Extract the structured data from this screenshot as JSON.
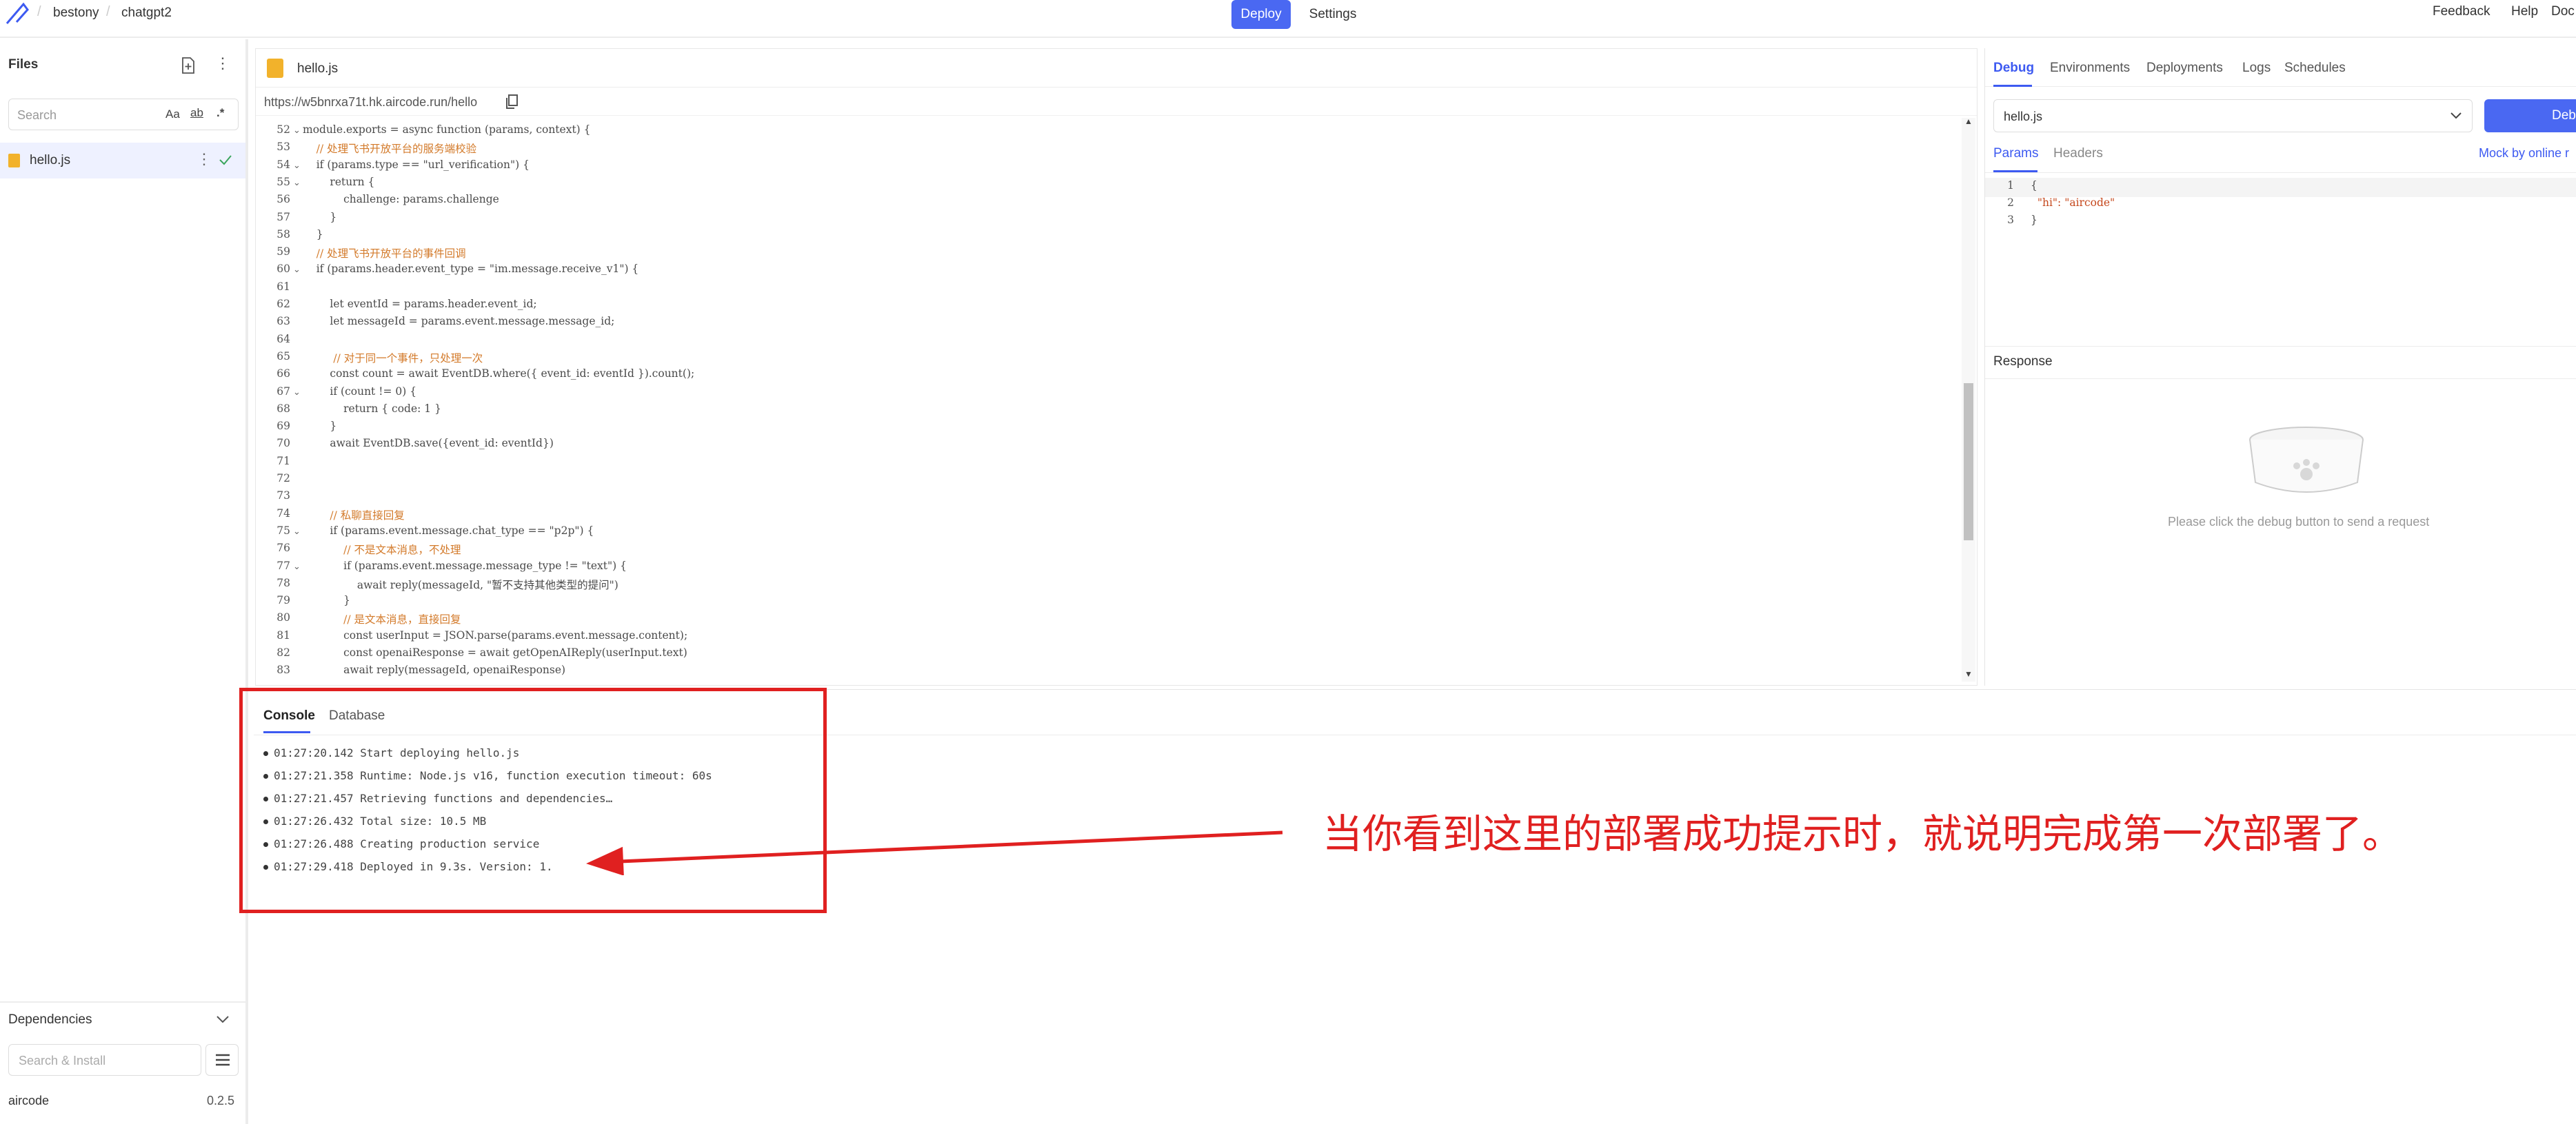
{
  "topbar": {
    "workspace": "bestony",
    "project": "chatgpt2",
    "deploy_label": "Deploy",
    "settings_label": "Settings",
    "feedback_label": "Feedback",
    "help_label": "Help",
    "docs_label": "Doc"
  },
  "sidebar": {
    "title": "Files",
    "search_placeholder": "Search",
    "opt_case": "Aa",
    "opt_word": "ab",
    "opt_regex": ".*",
    "files": [
      {
        "name": "hello.js"
      }
    ],
    "dependencies": {
      "title": "Dependencies",
      "search_placeholder": "Search & Install",
      "items": [
        {
          "name": "aircode",
          "version": "0.2.5"
        }
      ]
    }
  },
  "editor": {
    "tab_label": "hello.js",
    "url": "https://w5bnrxa71t.hk.aircode.run/hello",
    "lines": [
      {
        "n": "52",
        "text": "module.exports = async function (params, context) {"
      },
      {
        "n": "53",
        "text": "    // 处理飞书开放平台的服务端校验"
      },
      {
        "n": "54",
        "text": "    if (params.type == \"url_verification\") {"
      },
      {
        "n": "55",
        "text": "        return {"
      },
      {
        "n": "56",
        "text": "            challenge: params.challenge"
      },
      {
        "n": "57",
        "text": "        }"
      },
      {
        "n": "58",
        "text": "    }"
      },
      {
        "n": "59",
        "text": "    // 处理飞书开放平台的事件回调"
      },
      {
        "n": "60",
        "text": "    if (params.header.event_type = \"im.message.receive_v1\") {"
      },
      {
        "n": "61",
        "text": ""
      },
      {
        "n": "62",
        "text": "        let eventId = params.header.event_id;"
      },
      {
        "n": "63",
        "text": "        let messageId = params.event.message.message_id;"
      },
      {
        "n": "64",
        "text": ""
      },
      {
        "n": "65",
        "text": "         // 对于同一个事件，只处理一次"
      },
      {
        "n": "66",
        "text": "        const count = await EventDB.where({ event_id: eventId }).count();"
      },
      {
        "n": "67",
        "text": "        if (count != 0) {"
      },
      {
        "n": "68",
        "text": "            return { code: 1 }"
      },
      {
        "n": "69",
        "text": "        }"
      },
      {
        "n": "70",
        "text": "        await EventDB.save({event_id: eventId})"
      },
      {
        "n": "71",
        "text": ""
      },
      {
        "n": "72",
        "text": ""
      },
      {
        "n": "73",
        "text": ""
      },
      {
        "n": "74",
        "text": "        // 私聊直接回复"
      },
      {
        "n": "75",
        "text": "        if (params.event.message.chat_type == \"p2p\") {"
      },
      {
        "n": "76",
        "text": "            // 不是文本消息，不处理"
      },
      {
        "n": "77",
        "text": "            if (params.event.message.message_type != \"text\") {"
      },
      {
        "n": "78",
        "text": "                await reply(messageId, \"暂不支持其他类型的提问\")"
      },
      {
        "n": "79",
        "text": "            }"
      },
      {
        "n": "80",
        "text": "            // 是文本消息，直接回复"
      },
      {
        "n": "81",
        "text": "            const userInput = JSON.parse(params.event.message.content);"
      },
      {
        "n": "82",
        "text": "            const openaiResponse = await getOpenAIReply(userInput.text)"
      },
      {
        "n": "83",
        "text": "            await reply(messageId, openaiResponse)"
      }
    ]
  },
  "debug": {
    "tabs": [
      "Debug",
      "Environments",
      "Deployments",
      "Logs",
      "Schedules"
    ],
    "file_select": "hello.js",
    "debug_button": "Debug",
    "sub_tabs": [
      "Params",
      "Headers"
    ],
    "mock_label": "Mock by online r",
    "params_lines": [
      {
        "n": "1",
        "text": "{"
      },
      {
        "n": "2",
        "text": "  \"hi\": \"aircode\""
      },
      {
        "n": "3",
        "text": "}"
      }
    ],
    "response_title": "Response",
    "empty_hint": "Please click the debug button to send a request"
  },
  "console": {
    "tabs": [
      "Console",
      "Database"
    ],
    "logs": [
      {
        "time": "01:27:20.142",
        "msg": "Start deploying hello.js"
      },
      {
        "time": "01:27:21.358",
        "msg": "Runtime: Node.js v16, function execution timeout: 60s"
      },
      {
        "time": "01:27:21.457",
        "msg": "Retrieving functions and dependencies…"
      },
      {
        "time": "01:27:26.432",
        "msg": "Total size: 10.5 MB"
      },
      {
        "time": "01:27:26.488",
        "msg": "Creating production service"
      },
      {
        "time": "01:27:29.418",
        "msg": "Deployed in 9.3s. Version: 1."
      }
    ]
  },
  "annotation": {
    "text": "当你看到这里的部署成功提示时，就说明完成第一次部署了。",
    "color": "#e02020"
  },
  "colors": {
    "accent": "#4a68f2",
    "highlight": "#e02020"
  }
}
